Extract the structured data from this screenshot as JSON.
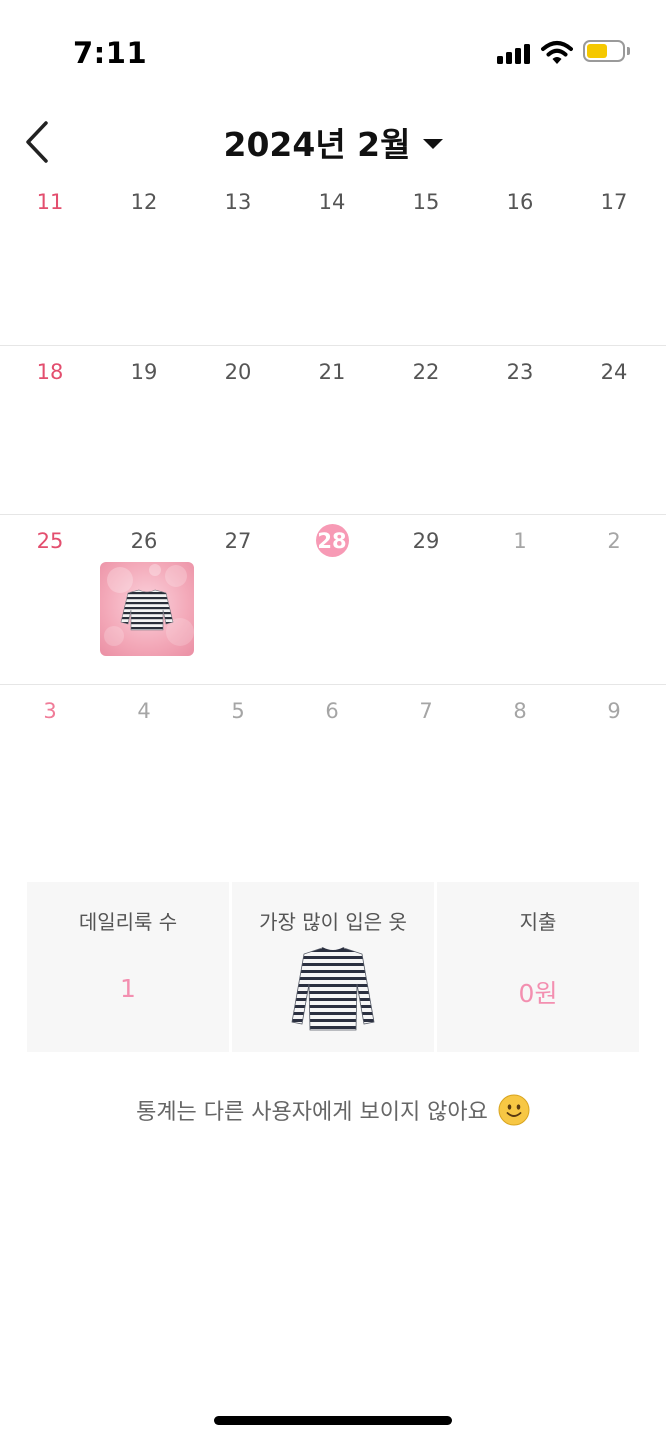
{
  "status_bar": {
    "time": "7:11",
    "battery_color": "#f5c800"
  },
  "header": {
    "month_title": "2024년 2월",
    "back_icon": "chevron-left-icon",
    "dropdown_icon": "caret-down-icon"
  },
  "calendar": {
    "accent_color": "#f79ab5",
    "sunday_color": "#e34e6e",
    "weeks": [
      [
        "11",
        "12",
        "13",
        "14",
        "15",
        "16",
        "17"
      ],
      [
        "18",
        "19",
        "20",
        "21",
        "22",
        "23",
        "24"
      ],
      [
        "25",
        "26",
        "27",
        "28",
        "29",
        "1",
        "2"
      ],
      [
        "3",
        "4",
        "5",
        "6",
        "7",
        "8",
        "9"
      ]
    ],
    "today": "28",
    "outfit_day": "26"
  },
  "stats": {
    "daily_look_label": "데일리룩 수",
    "daily_look_value": "1",
    "most_worn_label": "가장 많이 입은 옷",
    "spending_label": "지출",
    "spending_value": "0원"
  },
  "notice": {
    "text": "통계는 다른 사용자에게 보이지 않아요",
    "emoji_icon": "smile-emoji-icon"
  }
}
